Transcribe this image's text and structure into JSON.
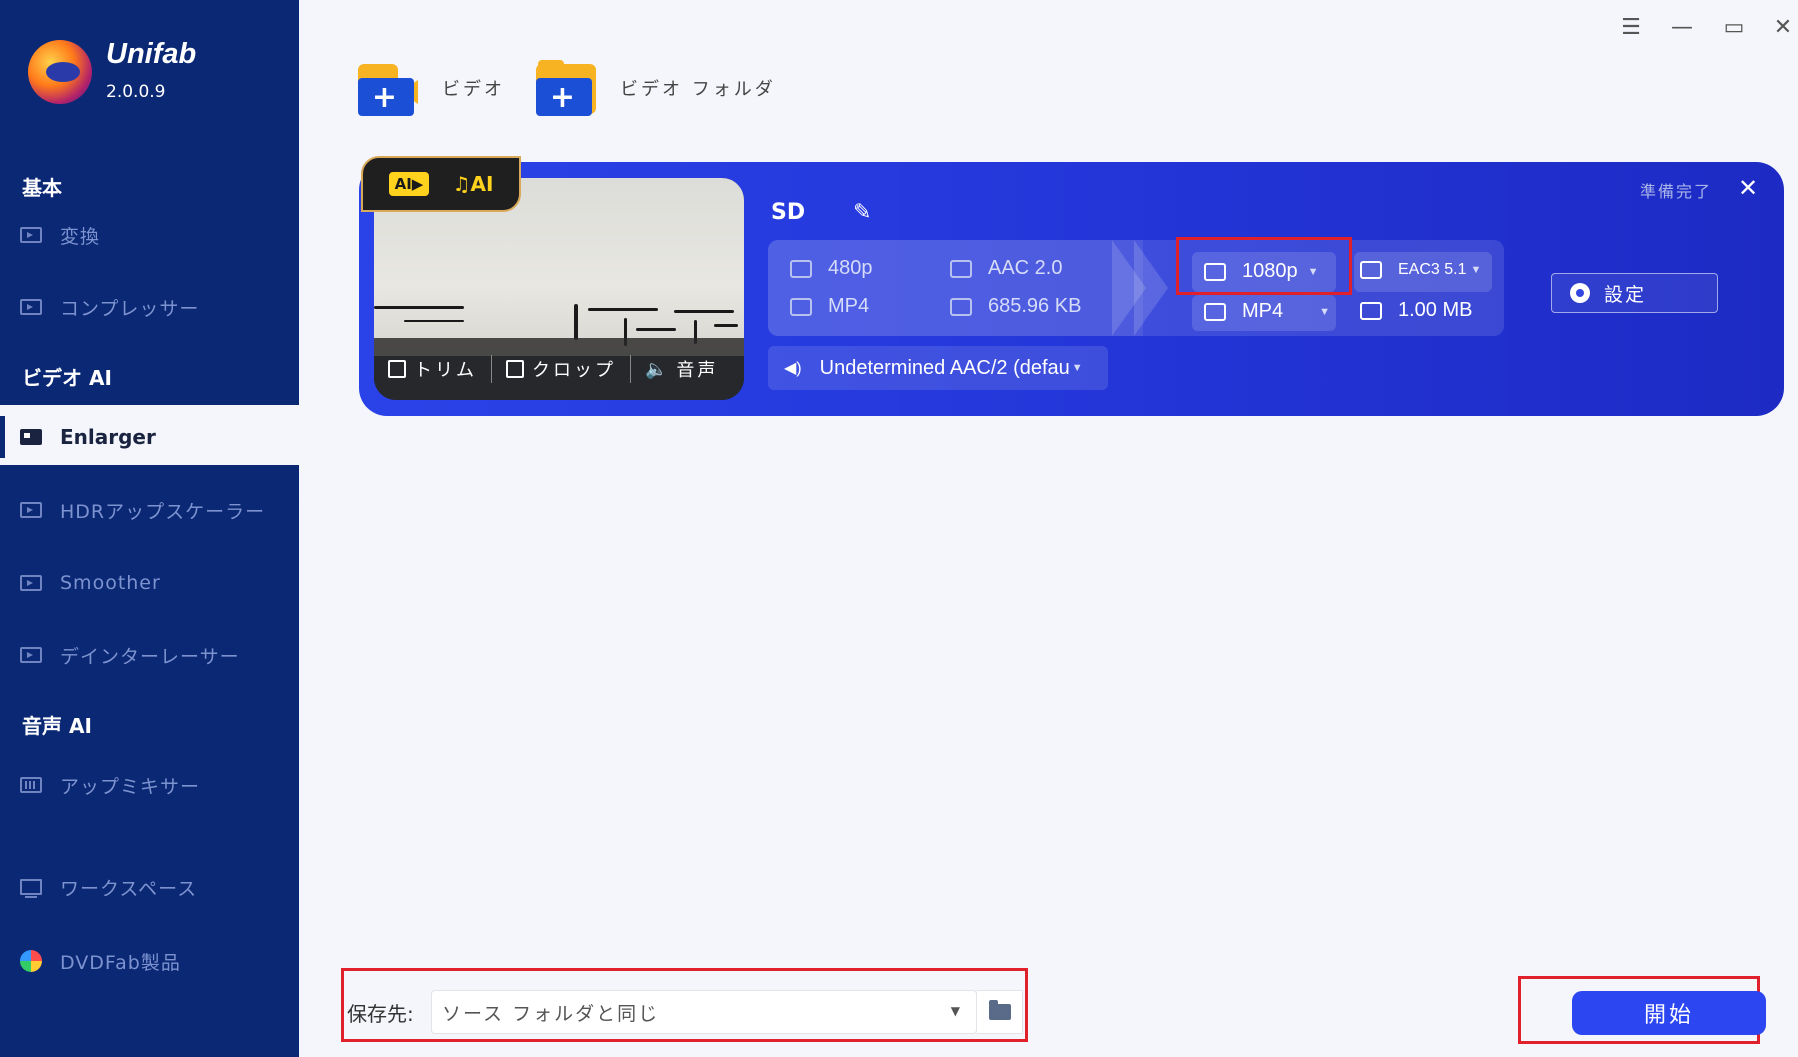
{
  "app": {
    "brand": "Unifab",
    "version": "2.0.0.9"
  },
  "sidebar": {
    "sections": {
      "basic": "基本",
      "video_ai": "ビデオ AI",
      "audio_ai": "音声 AI"
    },
    "items": {
      "convert": "変換",
      "compressor": "コンプレッサー",
      "enlarger": "Enlarger",
      "hdr": "HDRアップスケーラー",
      "smoother": "Smoother",
      "deinterlacer": "デインターレーサー",
      "upmixer": "アップミキサー",
      "workspace": "ワークスペース",
      "dvdfab": "DVDFab製品"
    },
    "active": "enlarger"
  },
  "toolbar": {
    "add_video": "ビデオ",
    "add_folder": "ビデオ フォルダ"
  },
  "task": {
    "title": "SD",
    "status": "準備完了",
    "thumb_tools": {
      "trim": "トリム",
      "crop": "クロップ",
      "audio": "音声"
    },
    "source": {
      "resolution": "480p",
      "container": "MP4",
      "audio": "AAC 2.0",
      "size": "685.96 KB"
    },
    "output": {
      "resolution": "1080p",
      "container": "MP4",
      "audio": "EAC3 5.1",
      "size": "1.00 MB"
    },
    "audio_track": "Undetermined AAC/2 (defau",
    "settings_label": "設定"
  },
  "bottom": {
    "save_label": "保存先:",
    "save_value": "ソース フォルダと同じ",
    "start_label": "開始"
  },
  "colors": {
    "sidebar_bg": "#0b2875",
    "card_bg": "#2a43e8",
    "start_bg": "#2c46f2",
    "highlight": "#e0202a"
  }
}
